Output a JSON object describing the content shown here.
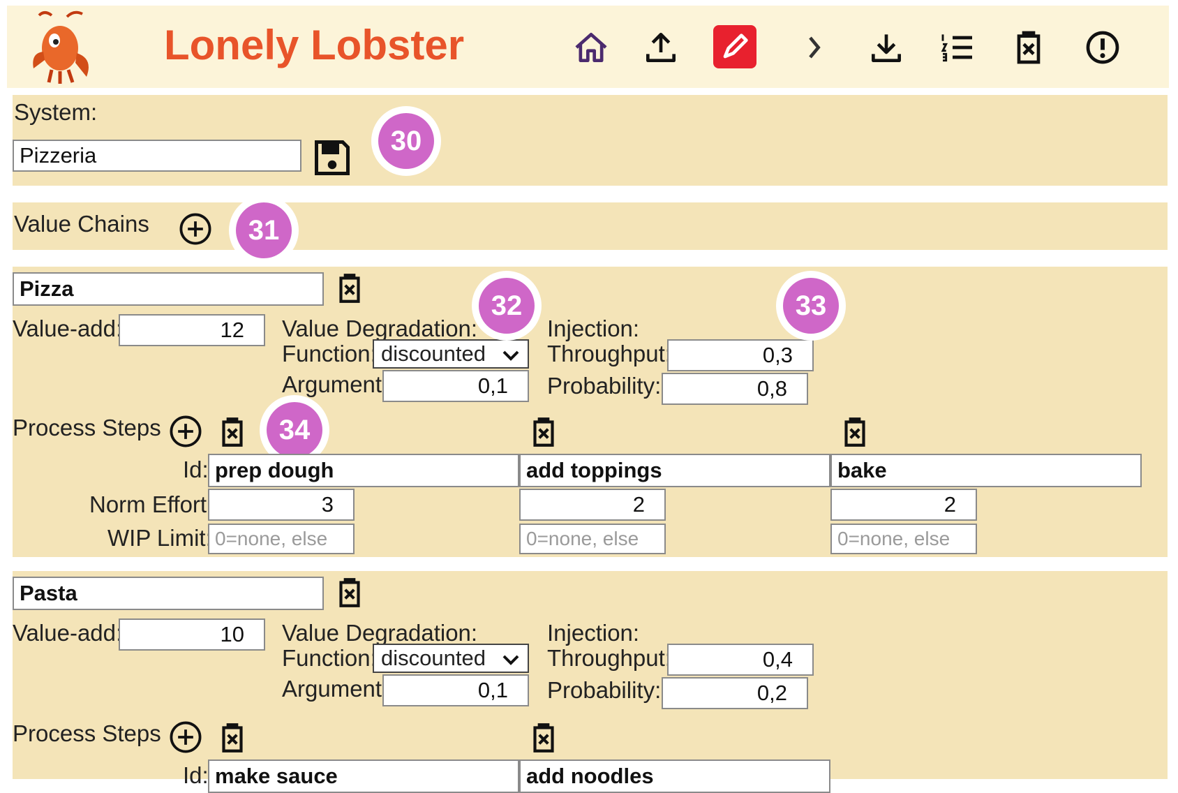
{
  "app": {
    "title": "Lonely Lobster"
  },
  "toolbar": {
    "icons": [
      "home-icon",
      "upload-icon",
      "edit-icon",
      "chevron-right-icon",
      "download-icon",
      "list-icon",
      "delete-icon",
      "alert-icon"
    ],
    "colors": {
      "active_edit": "#e8212e",
      "home": "#4b2a6e",
      "title": "#e8542a"
    }
  },
  "system": {
    "label": "System:",
    "name": "Pizzeria"
  },
  "value_chains": {
    "label": "Value Chains",
    "chains": [
      {
        "name": "Pizza",
        "value_add_label": "Value-add:",
        "value_add": "12",
        "degradation_label": "Value Degradation:",
        "function_label": "Function:",
        "function": "discounted",
        "argument_label": "Argument:",
        "argument": "0,1",
        "injection_label": "Injection:",
        "throughput_label": "Throughput:",
        "throughput": "0,3",
        "probability_label": "Probability:",
        "probability": "0,8",
        "process_steps_label": "Process Steps",
        "id_label": "Id:",
        "norm_effort_label": "Norm Effort:",
        "wip_limit_label": "WIP Limit:",
        "steps": [
          {
            "id": "prep dough",
            "norm_effort": "3",
            "wip_placeholder": "0=none, else"
          },
          {
            "id": "add toppings",
            "norm_effort": "2",
            "wip_placeholder": "0=none, else"
          },
          {
            "id": "bake",
            "norm_effort": "2",
            "wip_placeholder": "0=none, else"
          }
        ]
      },
      {
        "name": "Pasta",
        "value_add_label": "Value-add:",
        "value_add": "10",
        "degradation_label": "Value Degradation:",
        "function_label": "Function:",
        "function": "discounted",
        "argument_label": "Argument:",
        "argument": "0,1",
        "injection_label": "Injection:",
        "throughput_label": "Throughput:",
        "throughput": "0,4",
        "probability_label": "Probability:",
        "probability": "0,2",
        "process_steps_label": "Process Steps",
        "id_label": "Id:",
        "steps": [
          {
            "id": "make sauce"
          },
          {
            "id": "add noodles"
          }
        ]
      }
    ]
  },
  "annotations": [
    "30",
    "31",
    "32",
    "33",
    "34"
  ]
}
